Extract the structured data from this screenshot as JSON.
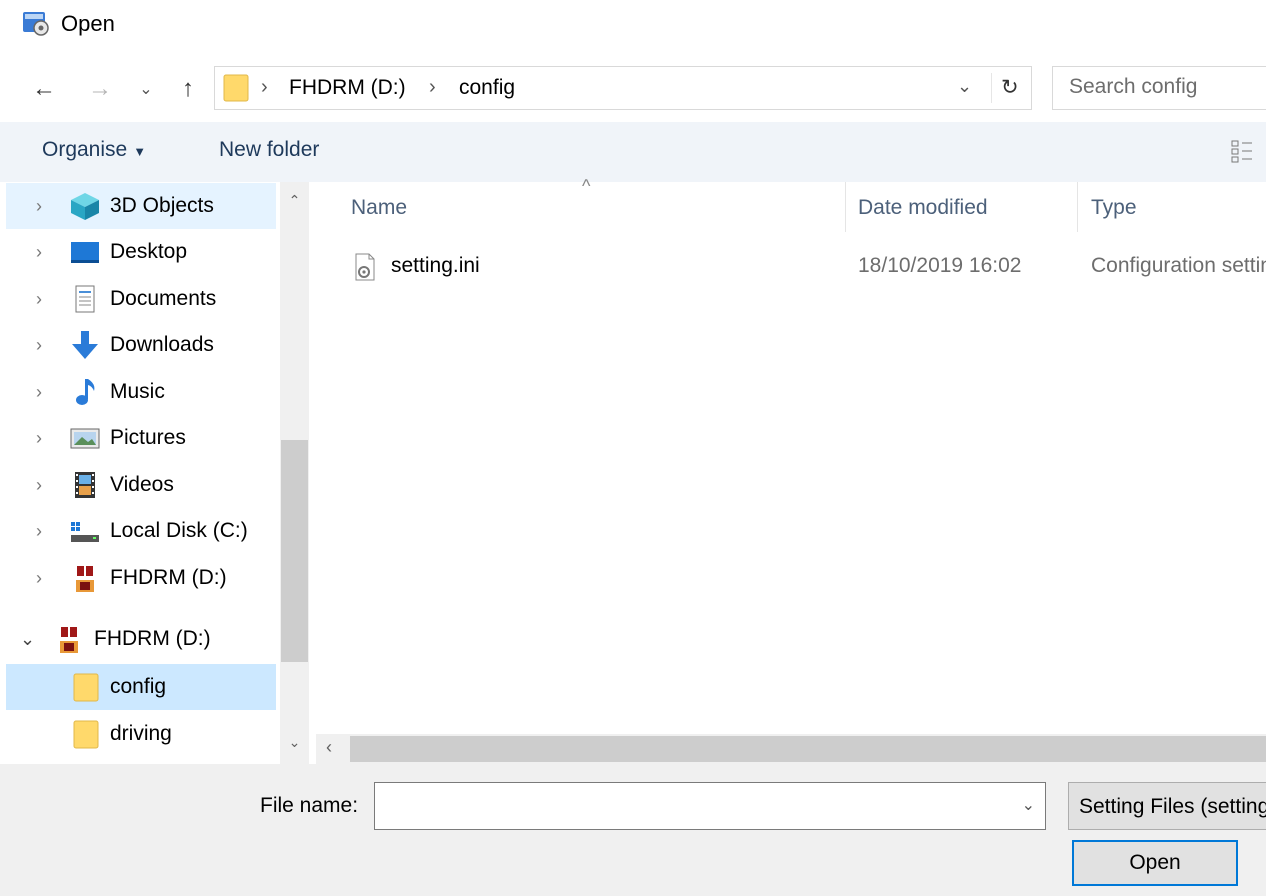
{
  "window": {
    "title": "Open"
  },
  "address": {
    "crumbs": [
      "FHDRM (D:)",
      "config"
    ],
    "search_placeholder": "Search config"
  },
  "toolbar": {
    "organise_label": "Organise",
    "new_folder_label": "New folder"
  },
  "nav": {
    "items": [
      {
        "label": "3D Objects"
      },
      {
        "label": "Desktop"
      },
      {
        "label": "Documents"
      },
      {
        "label": "Downloads"
      },
      {
        "label": "Music"
      },
      {
        "label": "Pictures"
      },
      {
        "label": "Videos"
      },
      {
        "label": "Local Disk (C:)"
      },
      {
        "label": "FHDRM (D:)"
      },
      {
        "label": "FHDRM (D:)"
      },
      {
        "label": "config"
      },
      {
        "label": "driving"
      }
    ]
  },
  "columns": {
    "name": "Name",
    "date": "Date modified",
    "type": "Type"
  },
  "files": [
    {
      "name": "setting.ini",
      "date": "18/10/2019 16:02",
      "type": "Configuration settings"
    }
  ],
  "bottom": {
    "file_name_label": "File name:",
    "file_name_value": "",
    "filter_label": "Setting Files (setting.ini)",
    "open_label": "Open"
  }
}
